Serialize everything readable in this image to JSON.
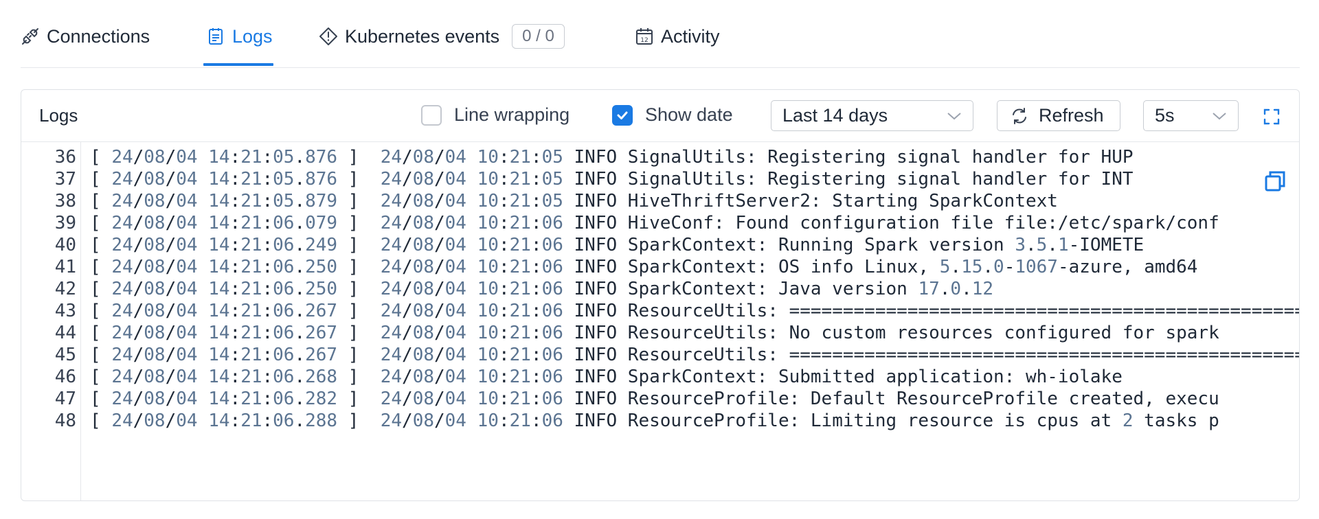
{
  "tabs": [
    {
      "label": "Connections",
      "icon": "plug-icon",
      "active": false
    },
    {
      "label": "Logs",
      "icon": "document-icon",
      "active": true
    },
    {
      "label": "Kubernetes events",
      "icon": "diamond-alert-icon",
      "active": false,
      "badge": "0 / 0"
    },
    {
      "label": "Activity",
      "icon": "calendar-icon",
      "active": false,
      "icon_text": "12"
    }
  ],
  "panel": {
    "title": "Logs",
    "line_wrapping": {
      "label": "Line wrapping",
      "checked": false
    },
    "show_date": {
      "label": "Show date",
      "checked": true
    },
    "range_select": "Last 14 days",
    "refresh_label": "Refresh",
    "interval_select": "5s"
  },
  "colors": {
    "accent": "#1a7ae3",
    "number": "#5b7491"
  },
  "log_lines": [
    {
      "n": "36",
      "text": "[ 24/08/04 14:21:05.876 ]  24/08/04 10:21:05 INFO SignalUtils: Registering signal handler for HUP"
    },
    {
      "n": "37",
      "text": "[ 24/08/04 14:21:05.876 ]  24/08/04 10:21:05 INFO SignalUtils: Registering signal handler for INT"
    },
    {
      "n": "38",
      "text": "[ 24/08/04 14:21:05.879 ]  24/08/04 10:21:05 INFO HiveThriftServer2: Starting SparkContext"
    },
    {
      "n": "39",
      "text": "[ 24/08/04 14:21:06.079 ]  24/08/04 10:21:06 INFO HiveConf: Found configuration file file:/etc/spark/conf"
    },
    {
      "n": "40",
      "text": "[ 24/08/04 14:21:06.249 ]  24/08/04 10:21:06 INFO SparkContext: Running Spark version 3.5.1-IOMETE"
    },
    {
      "n": "41",
      "text": "[ 24/08/04 14:21:06.250 ]  24/08/04 10:21:06 INFO SparkContext: OS info Linux, 5.15.0-1067-azure, amd64"
    },
    {
      "n": "42",
      "text": "[ 24/08/04 14:21:06.250 ]  24/08/04 10:21:06 INFO SparkContext: Java version 17.0.12"
    },
    {
      "n": "43",
      "text": "[ 24/08/04 14:21:06.267 ]  24/08/04 10:21:06 INFO ResourceUtils: ================================================"
    },
    {
      "n": "44",
      "text": "[ 24/08/04 14:21:06.267 ]  24/08/04 10:21:06 INFO ResourceUtils: No custom resources configured for spark"
    },
    {
      "n": "45",
      "text": "[ 24/08/04 14:21:06.267 ]  24/08/04 10:21:06 INFO ResourceUtils: ================================================"
    },
    {
      "n": "46",
      "text": "[ 24/08/04 14:21:06.268 ]  24/08/04 10:21:06 INFO SparkContext: Submitted application: wh-iolake"
    },
    {
      "n": "47",
      "text": "[ 24/08/04 14:21:06.282 ]  24/08/04 10:21:06 INFO ResourceProfile: Default ResourceProfile created, execu"
    },
    {
      "n": "48",
      "text": "[ 24/08/04 14:21:06.288 ]  24/08/04 10:21:06 INFO ResourceProfile: Limiting resource is cpus at 2 tasks p"
    }
  ]
}
